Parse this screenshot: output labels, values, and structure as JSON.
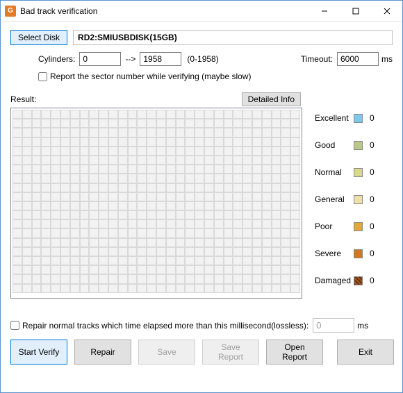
{
  "window": {
    "title": "Bad track verification"
  },
  "disk": {
    "select_label": "Select Disk",
    "name": "RD2:SMIUSBDISK(15GB)"
  },
  "cylinders": {
    "label": "Cylinders:",
    "from": "0",
    "arrow": "-->",
    "to": "1958",
    "range": "(0-1958)"
  },
  "timeout": {
    "label": "Timeout:",
    "value": "6000",
    "unit": "ms"
  },
  "option_report_sector": "Report the sector number while verifying (maybe slow)",
  "result": {
    "label": "Result:",
    "detailed_label": "Detailed Info"
  },
  "legend": {
    "excellent": {
      "label": "Excellent",
      "count": "0"
    },
    "good": {
      "label": "Good",
      "count": "0"
    },
    "normal": {
      "label": "Normal",
      "count": "0"
    },
    "general": {
      "label": "General",
      "count": "0"
    },
    "poor": {
      "label": "Poor",
      "count": "0"
    },
    "severe": {
      "label": "Severe",
      "count": "0"
    },
    "damaged": {
      "label": "Damaged",
      "count": "0"
    }
  },
  "repair_option": {
    "label": "Repair normal tracks which time elapsed more than this millisecond(lossless):",
    "value": "0",
    "unit": "ms"
  },
  "buttons": {
    "start_verify": "Start Verify",
    "repair": "Repair",
    "save": "Save",
    "save_report": "Save Report",
    "open_report": "Open Report",
    "exit": "Exit"
  }
}
